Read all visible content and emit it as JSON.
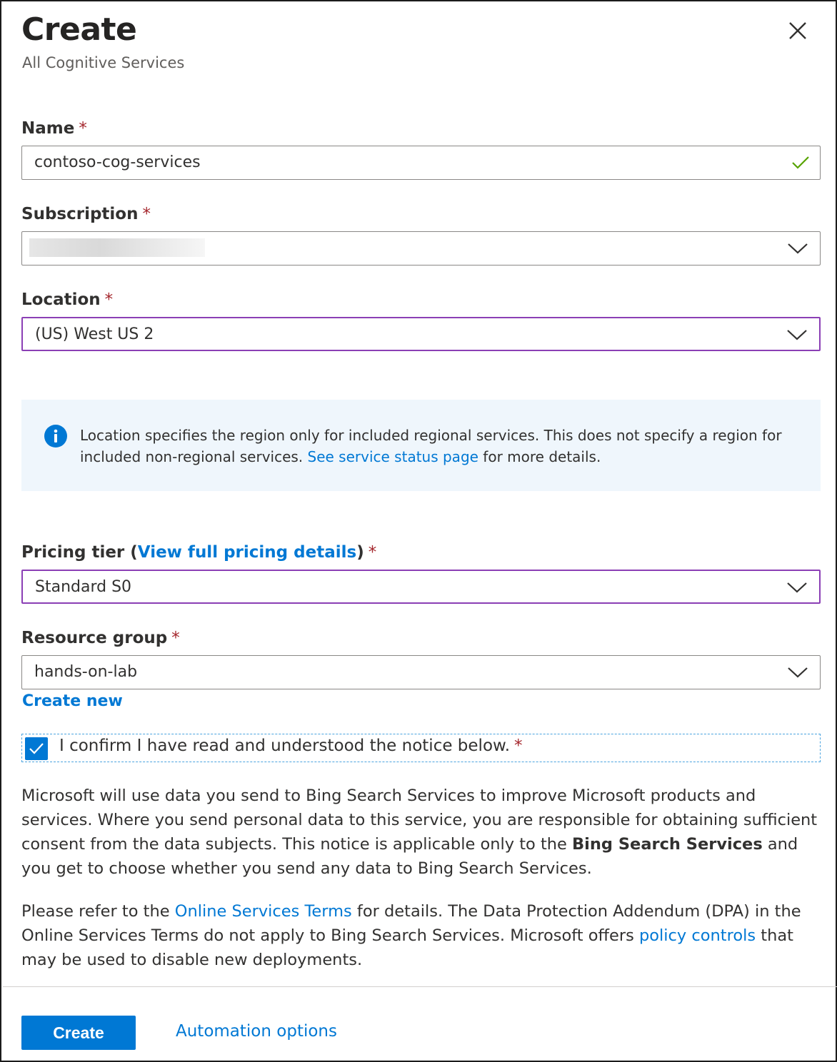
{
  "header": {
    "title": "Create",
    "subtitle": "All Cognitive Services"
  },
  "icons": {
    "close": "close-icon",
    "info": "info-icon",
    "check": "checkmark-icon",
    "chevron": "chevron-down-icon"
  },
  "colors": {
    "accent": "#0078d4",
    "required": "#a4262c",
    "focus_border": "#8b3fb5",
    "valid": "#57a300",
    "info_bg": "#eff6fc"
  },
  "form": {
    "name": {
      "label": "Name",
      "required": "*",
      "value": "contoso-cog-services"
    },
    "subscription": {
      "label": "Subscription",
      "required": "*",
      "value": ""
    },
    "location": {
      "label": "Location",
      "required": "*",
      "value": "(US) West US 2"
    },
    "info": {
      "text_before": "Location specifies the region only for included regional services. This does not specify a region for included non-regional services. ",
      "link": "See service status page",
      "text_after": " for more details."
    },
    "pricing": {
      "label": "Pricing tier (",
      "link": "View full pricing details",
      "label_end": ")",
      "required": "*",
      "value": "Standard S0"
    },
    "resource_group": {
      "label": "Resource group",
      "required": "*",
      "value": "hands-on-lab",
      "create_new": "Create new"
    },
    "confirm": {
      "label": "I confirm I have read and understood the notice below.",
      "required": "*",
      "checked": true
    }
  },
  "notice": {
    "p1_a": "Microsoft will use data you send to Bing Search Services to improve Microsoft products and services. Where you send personal data to this service, you are responsible for obtaining sufficient consent from the data subjects. This notice is applicable only to the ",
    "p1_bold": "Bing Search Services",
    "p1_b": " and you get to choose whether you send any data to Bing Search Services.",
    "p2_a": "Please refer to the ",
    "p2_link1": "Online Services Terms",
    "p2_b": " for details. The Data Protection Addendum (DPA) in the Online Services Terms do not apply to Bing Search Services. Microsoft offers ",
    "p2_link2": "policy controls",
    "p2_c": " that may be used to disable new deployments."
  },
  "footer": {
    "create_label": "Create",
    "automation_label": "Automation options"
  }
}
